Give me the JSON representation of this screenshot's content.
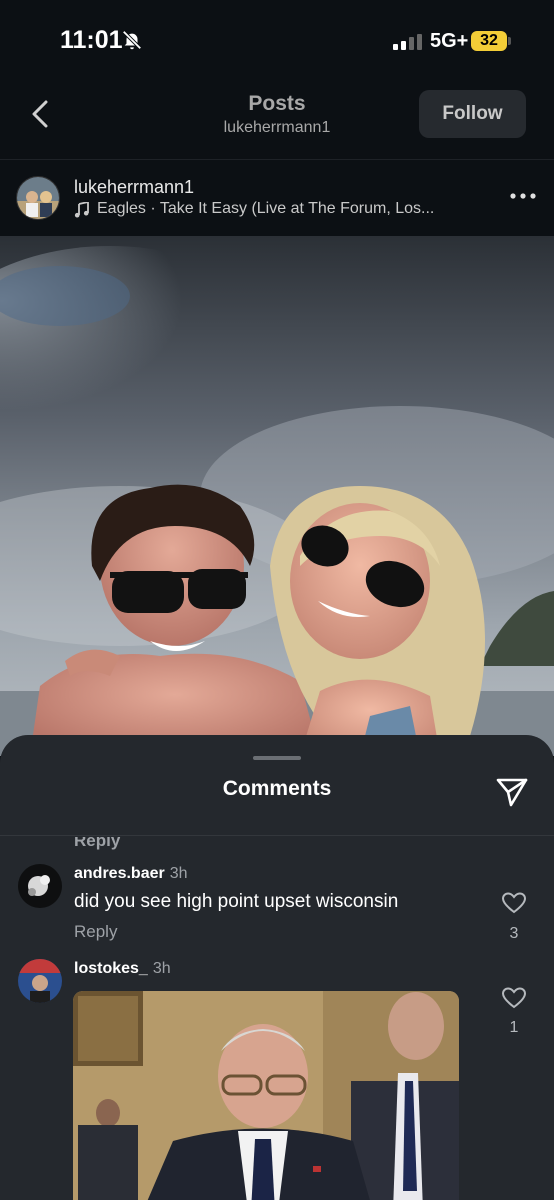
{
  "status_bar": {
    "time": "11:01",
    "network": "5G+",
    "battery": "32"
  },
  "header": {
    "title": "Posts",
    "subtitle": "lukeherrmann1",
    "follow_label": "Follow"
  },
  "post": {
    "username": "lukeherrmann1",
    "song": "Eagles · Take It Easy (Live at The Forum, Los..."
  },
  "comments_sheet": {
    "title": "Comments",
    "top_reply_label": "Reply",
    "comments": [
      {
        "user": "andres.baer",
        "time": "3h",
        "text": "did you see high point upset wisconsin",
        "reply_label": "Reply",
        "likes": "3"
      },
      {
        "user": "lostokes_",
        "time": "3h",
        "likes": "1"
      }
    ]
  },
  "icons": {
    "back": "chevron-left-icon",
    "more": "more-horizontal-icon",
    "music": "music-note-icon",
    "share": "paper-plane-icon",
    "heart": "heart-outline-icon",
    "bell": "bell-slash-icon"
  },
  "colors": {
    "background": "#0c1014",
    "sheet": "#24282d",
    "battery": "#f3cd37",
    "button": "#262a2f"
  }
}
